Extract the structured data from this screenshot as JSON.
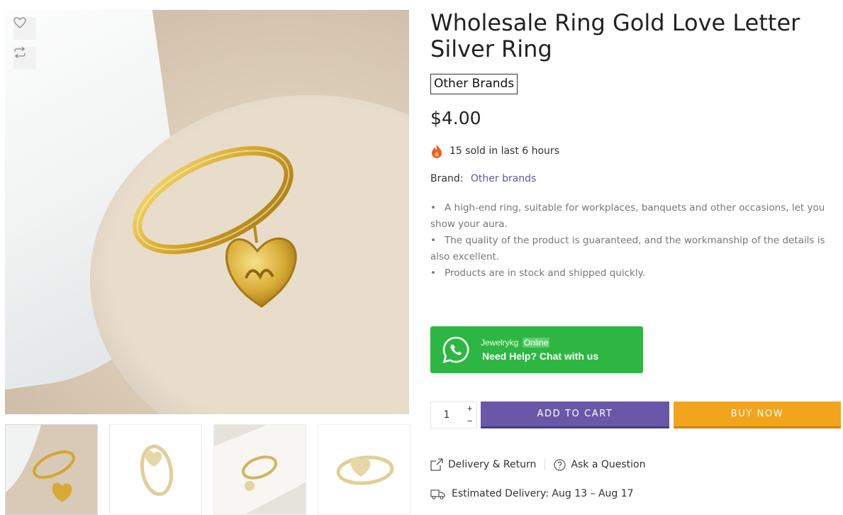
{
  "product": {
    "title": "Wholesale Ring Gold Love Letter Silver Ring",
    "brand_badge": "Other Brands",
    "price": "$4.00",
    "sold_text": "15 sold in last 6 hours",
    "brand_label": "Brand:",
    "brand_link": "Other brands",
    "description": [
      "A high-end ring, suitable for workplaces, banquets and other occasions, let you show your aura.",
      "The quality of the product is guaranteed, and the workmanship of the details is also excellent.",
      "Products are in stock and shipped quickly."
    ]
  },
  "whatsapp": {
    "name": "Jewelrykg",
    "status": "Online",
    "cta": "Need Help? Chat with us"
  },
  "cart": {
    "quantity": "1",
    "plus": "+",
    "minus": "−",
    "add_to_cart": "ADD TO CART",
    "buy_now": "BUY NOW"
  },
  "links": {
    "delivery_return": "Delivery & Return",
    "ask_question": "Ask a Question"
  },
  "delivery": {
    "estimated": "Estimated Delivery: Aug 13 – Aug 17"
  },
  "icons": {
    "wishlist": "heart-icon",
    "compare": "compare-icon",
    "fire": "fire-icon",
    "whatsapp": "whatsapp-icon",
    "share": "share-icon",
    "question": "question-icon",
    "truck": "truck-icon"
  },
  "colors": {
    "accent_purple": "#6a57a8",
    "accent_orange": "#f2a41c",
    "whatsapp_green": "#2db742",
    "brand_link": "#5b5aa6"
  }
}
